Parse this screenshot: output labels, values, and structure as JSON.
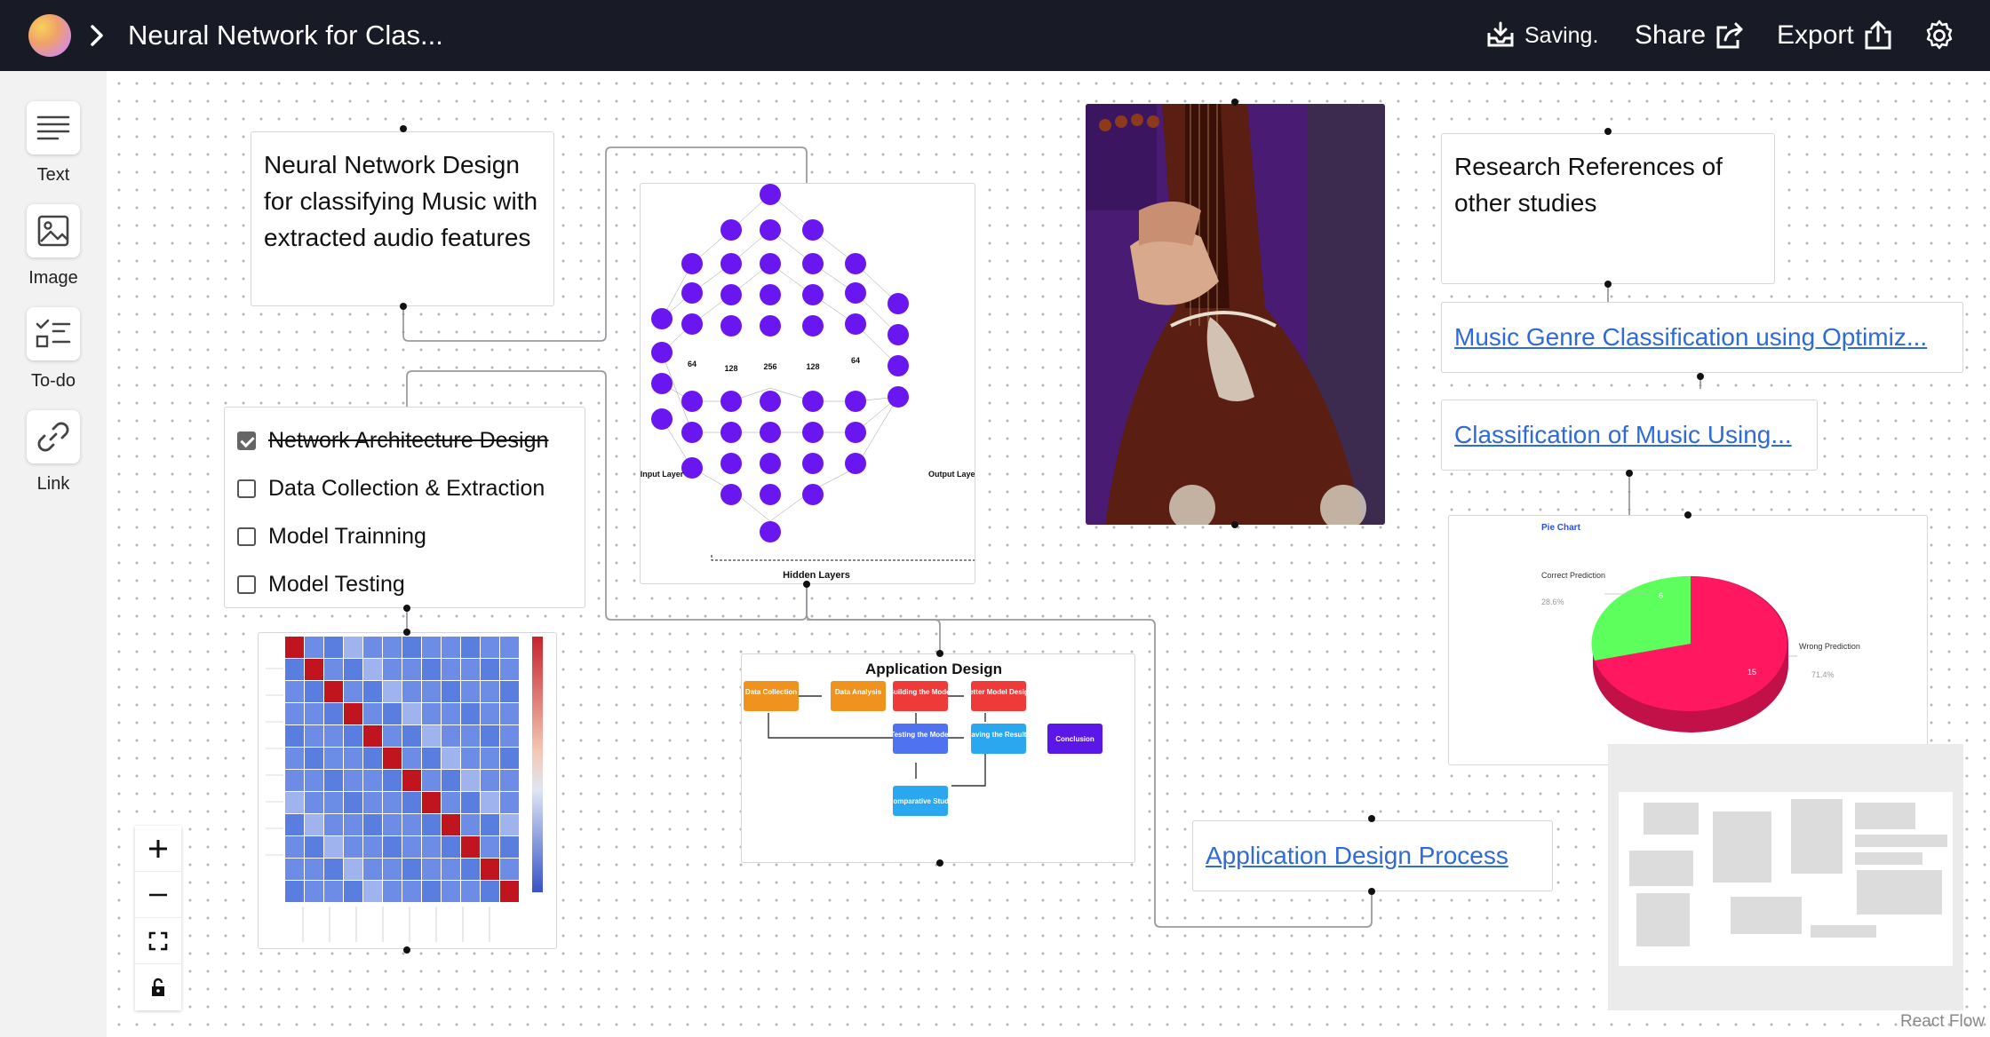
{
  "header": {
    "title": "Neural Network for Clas...",
    "saving_label": "Saving.",
    "share_label": "Share",
    "export_label": "Export"
  },
  "toolbar": {
    "items": [
      {
        "label": "Text",
        "icon": "text-lines-icon"
      },
      {
        "label": "Image",
        "icon": "image-icon"
      },
      {
        "label": "To-do",
        "icon": "checklist-icon"
      },
      {
        "label": "Link",
        "icon": "link-icon"
      }
    ]
  },
  "nodes": {
    "design_note": "Neural Network Design for classifying Music with extracted audio features",
    "research_note": "Research References of other studies",
    "todo": [
      {
        "label": "Network Architecture Design",
        "done": true
      },
      {
        "label": "Data Collection & Extraction",
        "done": false
      },
      {
        "label": "Model Trainning",
        "done": false
      },
      {
        "label": "Model Testing",
        "done": false
      }
    ],
    "links": {
      "genre": "Music Genre Classification using Optimiz...",
      "classification": "Classification of Music Using...",
      "app_process": "Application Design Process"
    },
    "nn_image": {
      "layer_sizes": [
        "64",
        "128",
        "256",
        "128",
        "64"
      ],
      "input_label": "Input Layer",
      "output_label": "Output Layer",
      "hidden_label": "Hidden Layers"
    },
    "app_design": {
      "title": "Application Design",
      "boxes": {
        "data_collection": "Data Collection",
        "data_analysis": "Data Analysis",
        "building_model": "Building the Model",
        "better_model": "Better Model Design",
        "testing_model": "Testing the Model",
        "saving_results": "Saving the Results",
        "conclusion": "Conclusion",
        "comparative": "Comparative Study"
      },
      "colors": {
        "orange": "#f0921e",
        "red": "#ef3a3a",
        "blue": "#4f73f0",
        "cyan": "#2aa7ee",
        "purple": "#5a17e8"
      }
    },
    "pie": {
      "title": "Pie Chart",
      "slices": [
        {
          "label": "Correct Prediction",
          "value": 6,
          "percent": "28.6%",
          "color": "#5cff5c"
        },
        {
          "label": "Wrong Prediction",
          "value": 15,
          "percent": "71.4%",
          "color": "#ff175f"
        }
      ]
    }
  },
  "footer": {
    "attribution": "React Flow"
  }
}
